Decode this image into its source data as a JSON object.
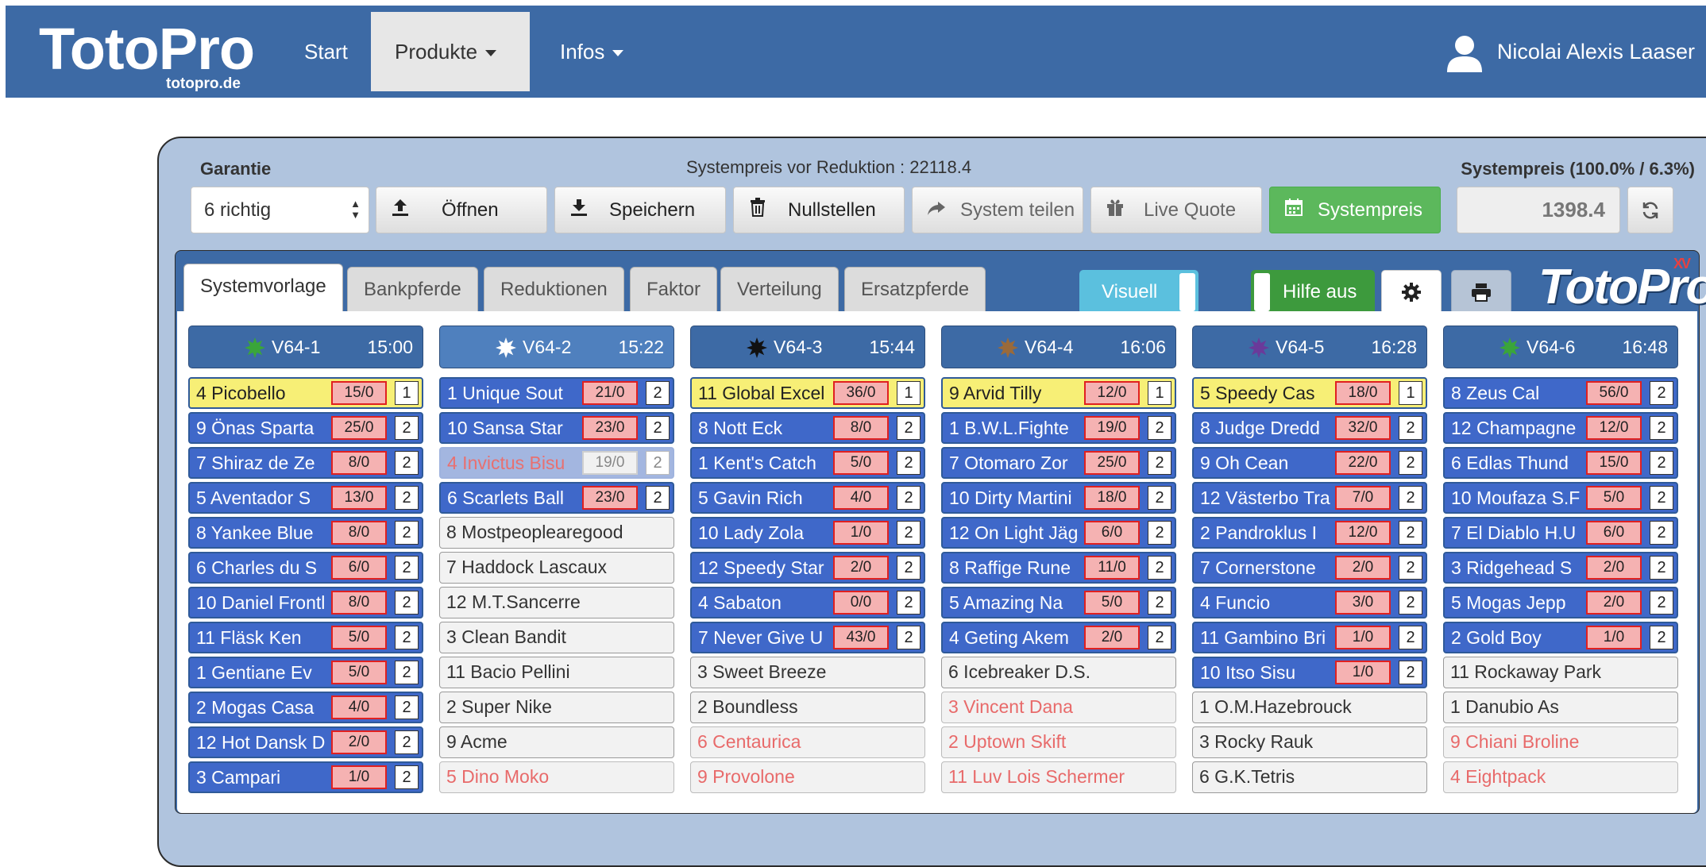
{
  "nav": {
    "logo": "TotoPro",
    "logo_sub": "totopro.de",
    "links": [
      "Start",
      "Produkte",
      "Infos"
    ],
    "user": "Nicolai Alexis Laaser"
  },
  "toolbar": {
    "garantie_label": "Garantie",
    "garantie_value": "6 richtig",
    "price_before": "Systempreis vor Reduktion : 22118.4",
    "price_label": "Systempreis (100.0% / 6.3%)",
    "price_value": "1398.4",
    "buttons": [
      "Öffnen",
      "Speichern",
      "Nullstellen",
      "System teilen",
      "Live Quote",
      "Systempreis"
    ]
  },
  "tabs": [
    "Systemvorlage",
    "Bankpferde",
    "Reduktionen",
    "Faktor",
    "Verteilung",
    "Ersatzpferde"
  ],
  "toggles": {
    "visuell": "Visuell",
    "hilfe": "Hilfe aus"
  },
  "logo2": {
    "main": "TotoPro",
    "sup": "XV"
  },
  "colors": {
    "blue": "#3f68c9",
    "yellow": "#f7ef76",
    "odds_red": "#e02020",
    "green": "#5cb85c"
  },
  "races": [
    {
      "name": "V64-1",
      "time": "15:00",
      "star": "#3aa53a",
      "horses": [
        {
          "name": "4 Picobello",
          "odds": "15/0",
          "pick": "1",
          "st": "yellow"
        },
        {
          "name": "9 Önas Sparta",
          "odds": "25/0",
          "pick": "2",
          "st": "blue"
        },
        {
          "name": "7 Shiraz de Ze",
          "odds": "8/0",
          "pick": "2",
          "st": "blue"
        },
        {
          "name": "5 Aventador S",
          "odds": "13/0",
          "pick": "2",
          "st": "blue"
        },
        {
          "name": "8 Yankee Blue",
          "odds": "8/0",
          "pick": "2",
          "st": "blue"
        },
        {
          "name": "6 Charles du S",
          "odds": "6/0",
          "pick": "2",
          "st": "blue"
        },
        {
          "name": "10 Daniel Frontl",
          "odds": "8/0",
          "pick": "2",
          "st": "blue"
        },
        {
          "name": "11 Fläsk Ken",
          "odds": "5/0",
          "pick": "2",
          "st": "blue"
        },
        {
          "name": "1 Gentiane Ev",
          "odds": "5/0",
          "pick": "2",
          "st": "blue"
        },
        {
          "name": "2 Mogas Casa",
          "odds": "4/0",
          "pick": "2",
          "st": "blue"
        },
        {
          "name": "12 Hot Dansk D",
          "odds": "2/0",
          "pick": "2",
          "st": "blue"
        },
        {
          "name": "3 Campari",
          "odds": "1/0",
          "pick": "2",
          "st": "blue"
        }
      ]
    },
    {
      "name": "V64-2",
      "time": "15:22",
      "star": "#ffffff",
      "horses": [
        {
          "name": "1 Unique Sout",
          "odds": "21/0",
          "pick": "2",
          "st": "blue"
        },
        {
          "name": "10 Sansa Star",
          "odds": "23/0",
          "pick": "2",
          "st": "blue"
        },
        {
          "name": "4 Invictus Bisu",
          "odds": "19/0",
          "pick": "2",
          "st": "fade"
        },
        {
          "name": "6 Scarlets Ball",
          "odds": "23/0",
          "pick": "2",
          "st": "blue"
        },
        {
          "name": "8 Mostpeoplearegood",
          "st": "grey"
        },
        {
          "name": "7 Haddock Lascaux",
          "st": "grey"
        },
        {
          "name": "12 M.T.Sancerre",
          "st": "grey"
        },
        {
          "name": "3 Clean Bandit",
          "st": "grey"
        },
        {
          "name": "11 Bacio Pellini",
          "st": "grey"
        },
        {
          "name": "2 Super Nike",
          "st": "grey"
        },
        {
          "name": "9 Acme",
          "st": "grey"
        },
        {
          "name": "5 Dino Moko",
          "st": "scr"
        }
      ]
    },
    {
      "name": "V64-3",
      "time": "15:44",
      "star": "#111111",
      "horses": [
        {
          "name": "11 Global Excel",
          "odds": "36/0",
          "pick": "1",
          "st": "yellow"
        },
        {
          "name": "8 Nott Eck",
          "odds": "8/0",
          "pick": "2",
          "st": "blue"
        },
        {
          "name": "1 Kent's Catch",
          "odds": "5/0",
          "pick": "2",
          "st": "blue"
        },
        {
          "name": "5 Gavin Rich",
          "odds": "4/0",
          "pick": "2",
          "st": "blue"
        },
        {
          "name": "10 Lady Zola",
          "odds": "1/0",
          "pick": "2",
          "st": "blue"
        },
        {
          "name": "12 Speedy Star",
          "odds": "2/0",
          "pick": "2",
          "st": "blue"
        },
        {
          "name": "4 Sabaton",
          "odds": "0/0",
          "pick": "2",
          "st": "blue"
        },
        {
          "name": "7 Never Give U",
          "odds": "43/0",
          "pick": "2",
          "st": "blue"
        },
        {
          "name": "3 Sweet Breeze",
          "st": "grey"
        },
        {
          "name": "2 Boundless",
          "st": "grey"
        },
        {
          "name": "6 Centaurica",
          "st": "scr"
        },
        {
          "name": "9 Provolone",
          "st": "scr"
        }
      ]
    },
    {
      "name": "V64-4",
      "time": "16:06",
      "star": "#9a6a3a",
      "horses": [
        {
          "name": "9 Arvid Tilly",
          "odds": "12/0",
          "pick": "1",
          "st": "yellow"
        },
        {
          "name": "1 B.W.L.Fighte",
          "odds": "19/0",
          "pick": "2",
          "st": "blue"
        },
        {
          "name": "7 Otomaro Zor",
          "odds": "25/0",
          "pick": "2",
          "st": "blue"
        },
        {
          "name": "10 Dirty Martini",
          "odds": "18/0",
          "pick": "2",
          "st": "blue"
        },
        {
          "name": "12 On Light Jäg",
          "odds": "6/0",
          "pick": "2",
          "st": "blue"
        },
        {
          "name": "8 Raffige Rune",
          "odds": "11/0",
          "pick": "2",
          "st": "blue"
        },
        {
          "name": "5 Amazing Na",
          "odds": "5/0",
          "pick": "2",
          "st": "blue"
        },
        {
          "name": "4 Geting Akem",
          "odds": "2/0",
          "pick": "2",
          "st": "blue"
        },
        {
          "name": "6 Icebreaker D.S.",
          "st": "grey"
        },
        {
          "name": "3 Vincent Dana",
          "st": "scr"
        },
        {
          "name": "2 Uptown Skift",
          "st": "scr"
        },
        {
          "name": "11 Luv Lois Schermer",
          "st": "scr"
        }
      ]
    },
    {
      "name": "V64-5",
      "time": "16:28",
      "star": "#6a3a9a",
      "horses": [
        {
          "name": "5 Speedy Cas",
          "odds": "18/0",
          "pick": "1",
          "st": "yellow"
        },
        {
          "name": "8 Judge Dredd",
          "odds": "32/0",
          "pick": "2",
          "st": "blue"
        },
        {
          "name": "9 Oh Cean",
          "odds": "22/0",
          "pick": "2",
          "st": "blue"
        },
        {
          "name": "12 Västerbo Tra",
          "odds": "7/0",
          "pick": "2",
          "st": "blue"
        },
        {
          "name": "2 Pandroklus I",
          "odds": "12/0",
          "pick": "2",
          "st": "blue"
        },
        {
          "name": "7 Cornerstone",
          "odds": "2/0",
          "pick": "2",
          "st": "blue"
        },
        {
          "name": "4 Funcio",
          "odds": "3/0",
          "pick": "2",
          "st": "blue"
        },
        {
          "name": "11 Gambino Bri",
          "odds": "1/0",
          "pick": "2",
          "st": "blue"
        },
        {
          "name": "10 Itso Sisu",
          "odds": "1/0",
          "pick": "2",
          "st": "blue"
        },
        {
          "name": "1 O.M.Hazebrouck",
          "st": "grey"
        },
        {
          "name": "3 Rocky Rauk",
          "st": "grey"
        },
        {
          "name": "6 G.K.Tetris",
          "st": "grey"
        }
      ]
    },
    {
      "name": "V64-6",
      "time": "16:48",
      "star": "#3aa53a",
      "horses": [
        {
          "name": "8 Zeus Cal",
          "odds": "56/0",
          "pick": "2",
          "st": "blue"
        },
        {
          "name": "12 Champagne",
          "odds": "12/0",
          "pick": "2",
          "st": "blue"
        },
        {
          "name": "6 Edlas Thund",
          "odds": "15/0",
          "pick": "2",
          "st": "blue"
        },
        {
          "name": "10 Moufaza S.F",
          "odds": "5/0",
          "pick": "2",
          "st": "blue"
        },
        {
          "name": "7 El Diablo H.U",
          "odds": "6/0",
          "pick": "2",
          "st": "blue"
        },
        {
          "name": "3 Ridgehead S",
          "odds": "2/0",
          "pick": "2",
          "st": "blue"
        },
        {
          "name": "5 Mogas Jepp",
          "odds": "2/0",
          "pick": "2",
          "st": "blue"
        },
        {
          "name": "2 Gold Boy",
          "odds": "1/0",
          "pick": "2",
          "st": "blue"
        },
        {
          "name": "11 Rockaway Park",
          "st": "grey"
        },
        {
          "name": "1 Danubio As",
          "st": "grey"
        },
        {
          "name": "9 Chiani Broline",
          "st": "scr"
        },
        {
          "name": "4 Eightpack",
          "st": "scr"
        }
      ]
    }
  ]
}
